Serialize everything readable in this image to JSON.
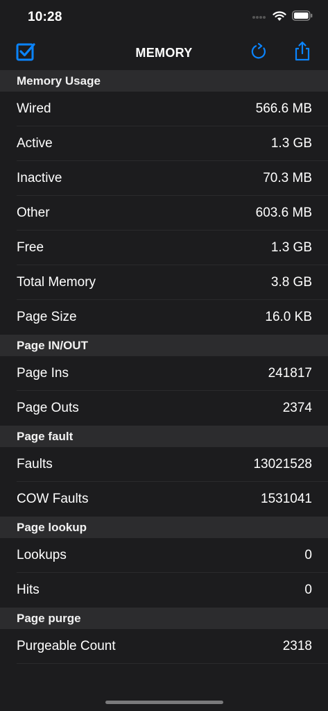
{
  "status_bar": {
    "time": "10:28"
  },
  "nav": {
    "title": "MEMORY"
  },
  "icons": {
    "select": "checkbox-checked-icon",
    "refresh": "refresh-icon",
    "share": "share-icon",
    "accent_color": "#0a84ff"
  },
  "sections": [
    {
      "header": "Memory Usage",
      "rows": [
        {
          "label": "Wired",
          "value": "566.6 MB"
        },
        {
          "label": "Active",
          "value": "1.3 GB"
        },
        {
          "label": "Inactive",
          "value": "70.3 MB"
        },
        {
          "label": "Other",
          "value": "603.6 MB"
        },
        {
          "label": "Free",
          "value": "1.3 GB"
        },
        {
          "label": "Total Memory",
          "value": "3.8 GB"
        },
        {
          "label": "Page Size",
          "value": "16.0 KB"
        }
      ]
    },
    {
      "header": "Page IN/OUT",
      "rows": [
        {
          "label": "Page Ins",
          "value": "241817"
        },
        {
          "label": "Page Outs",
          "value": "2374"
        }
      ]
    },
    {
      "header": "Page fault",
      "rows": [
        {
          "label": "Faults",
          "value": "13021528"
        },
        {
          "label": "COW Faults",
          "value": "1531041"
        }
      ]
    },
    {
      "header": "Page lookup",
      "rows": [
        {
          "label": "Lookups",
          "value": "0"
        },
        {
          "label": "Hits",
          "value": "0"
        }
      ]
    },
    {
      "header": "Page purge",
      "rows": [
        {
          "label": "Purgeable Count",
          "value": "2318"
        }
      ]
    }
  ]
}
